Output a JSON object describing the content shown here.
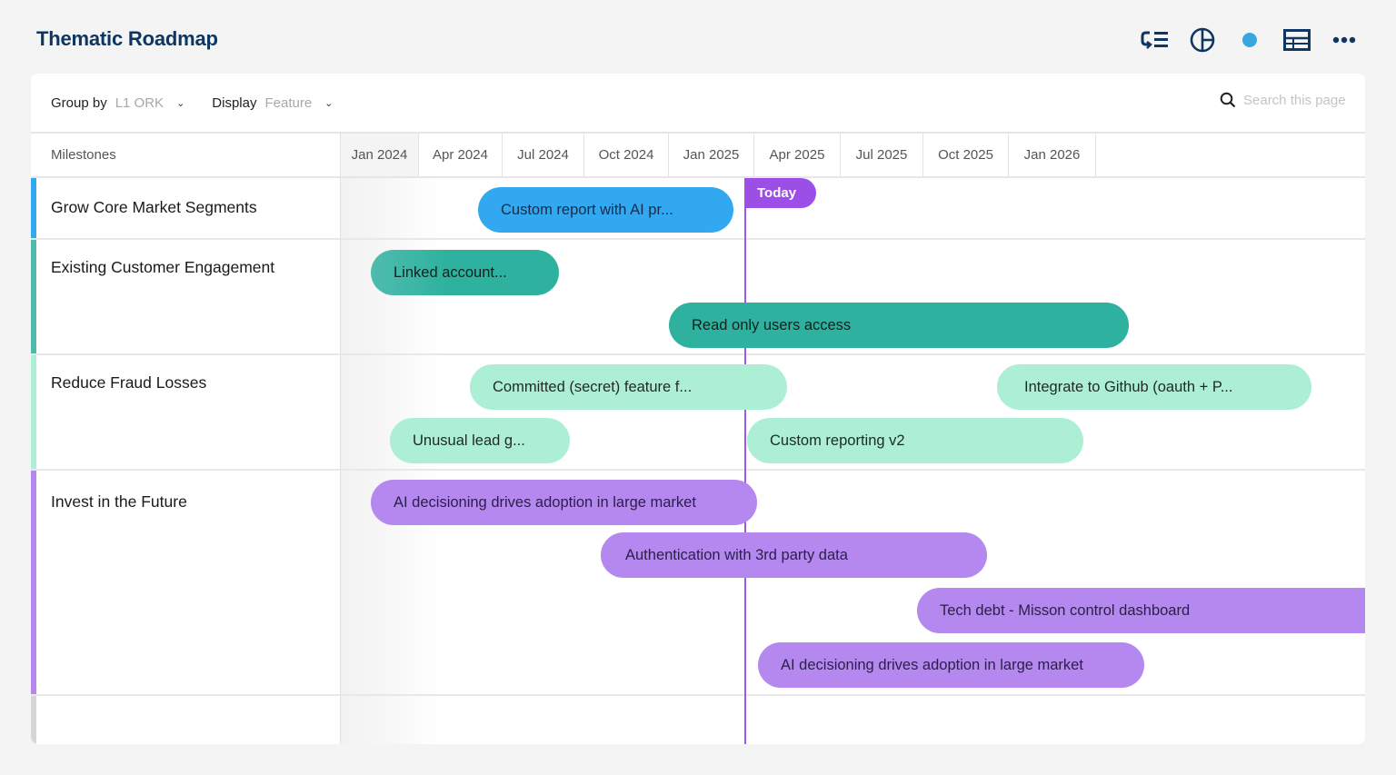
{
  "app": {
    "title": "Thematic Roadmap"
  },
  "top_icons": [
    {
      "name": "swimlane-list-icon"
    },
    {
      "name": "pie-chart-icon"
    },
    {
      "name": "status-dot-icon",
      "color": "#3aa6e0"
    },
    {
      "name": "layout-table-icon"
    },
    {
      "name": "more-options-icon"
    }
  ],
  "toolbar": {
    "group_by_label": "Group by",
    "group_by_value": "L1 ORK",
    "display_label": "Display",
    "display_value": "Feature",
    "search_placeholder": "Search this page"
  },
  "grid": {
    "milestones_header": "Milestones",
    "months": [
      "Jan 2024",
      "Apr 2024",
      "Jul 2024",
      "Oct 2024",
      "Jan 2025",
      "Apr 2025",
      "Jul 2025",
      "Oct 2025",
      "Jan 2026"
    ],
    "today_label": "Today"
  },
  "groups": [
    {
      "name": "Grow Core Market Segments",
      "color": "#31a8ef"
    },
    {
      "name": "Existing Customer Engagement",
      "color": "#4fb9aa"
    },
    {
      "name": "Reduce Fraud Losses",
      "color": "#acefd5"
    },
    {
      "name": "Invest in the Future",
      "color": "#b488ee"
    }
  ],
  "features": [
    {
      "label": "Custom report with AI pr...",
      "group": 0,
      "color": "#31a8ef"
    },
    {
      "label": "Linked account...",
      "group": 1,
      "color": "#2eb29f"
    },
    {
      "label": "Read only users access",
      "group": 1,
      "color": "#2eb29f"
    },
    {
      "label": "Committed (secret) feature f...",
      "group": 2,
      "color": "#acefd5"
    },
    {
      "label": "Integrate to Github (oauth + P...",
      "group": 2,
      "color": "#acefd5"
    },
    {
      "label": "Unusual lead g...",
      "group": 2,
      "color": "#acefd5"
    },
    {
      "label": "Custom reporting v2",
      "group": 2,
      "color": "#acefd5"
    },
    {
      "label": "AI decisioning drives adoption in large market",
      "group": 3,
      "color": "#b488ee"
    },
    {
      "label": "Authentication with 3rd party data",
      "group": 3,
      "color": "#b488ee"
    },
    {
      "label": "Tech debt - Misson control dashboard",
      "group": 3,
      "color": "#b488ee"
    },
    {
      "label": "AI decisioning drives adoption in large market",
      "group": 3,
      "color": "#b488ee"
    }
  ]
}
